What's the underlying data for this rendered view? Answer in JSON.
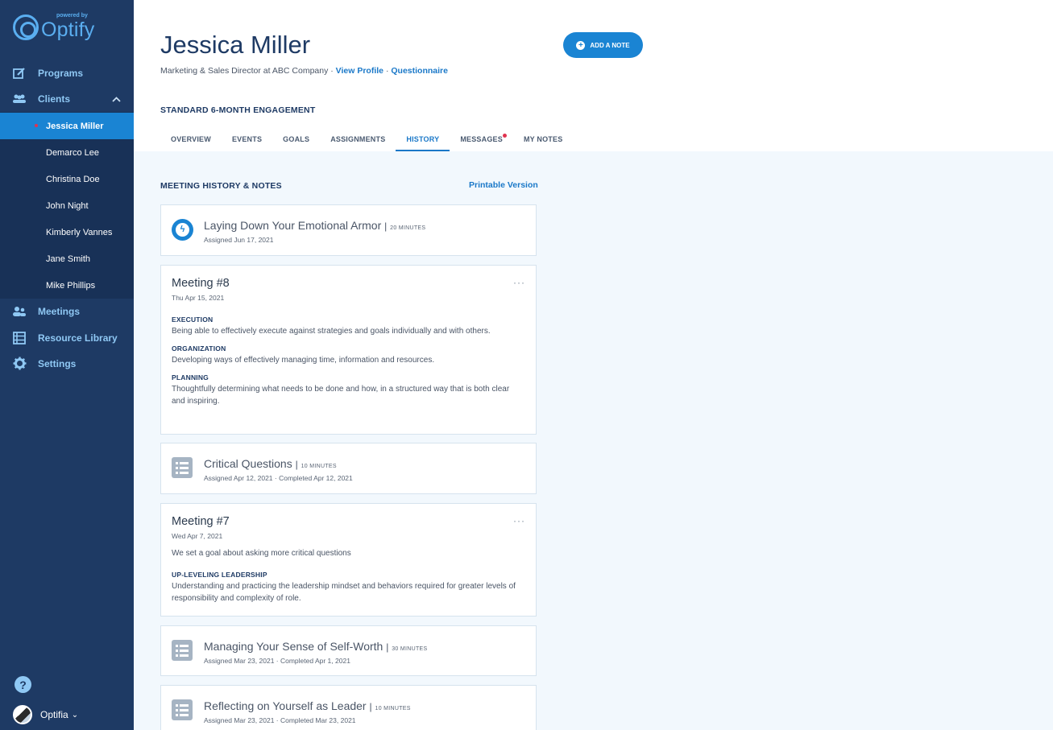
{
  "brand": {
    "powered_by": "powered by",
    "name": "Optify"
  },
  "nav": {
    "programs": "Programs",
    "clients": "Clients",
    "meetings": "Meetings",
    "resource_library": "Resource Library",
    "settings": "Settings"
  },
  "clients": [
    "Jessica Miller",
    "Demarco Lee",
    "Christina Doe",
    "John Night",
    "Kimberly Vannes",
    "Jane Smith",
    "Mike Phillips"
  ],
  "user": {
    "name": "Optifia",
    "caret": "⌄"
  },
  "header": {
    "client_name": "Jessica Miller",
    "role": "Marketing & Sales Director at ABC Company ·",
    "view_profile": "View Profile",
    "dot": "·",
    "questionnaire": "Questionnaire",
    "add_note": "ADD A NOTE",
    "engagement": "STANDARD 6-MONTH ENGAGEMENT"
  },
  "tabs": [
    "OVERVIEW",
    "EVENTS",
    "GOALS",
    "ASSIGNMENTS",
    "HISTORY",
    "MESSAGES",
    "MY NOTES"
  ],
  "history": {
    "title": "MEETING HISTORY & NOTES",
    "printable": "Printable Version",
    "items": [
      {
        "title": "Laying Down Your Emotional Armor",
        "duration": "20 MINUTES",
        "sub": "Assigned Jun 17, 2021"
      },
      {
        "title": "Meeting #8",
        "date": "Thu Apr 15, 2021",
        "more": "···",
        "topics": [
          {
            "name": "EXECUTION",
            "desc": "Being able to effectively execute against strategies and goals individually and with others."
          },
          {
            "name": "ORGANIZATION",
            "desc": "Developing ways of effectively managing time, information and resources."
          },
          {
            "name": "PLANNING",
            "desc": "Thoughtfully determining what needs to be done and how, in a structured way that is both clear and inspiring."
          }
        ]
      },
      {
        "title": "Critical Questions",
        "duration": "10 MINUTES",
        "sub": "Assigned Apr 12, 2021 · Completed Apr 12, 2021"
      },
      {
        "title": "Meeting #7",
        "date": "Wed Apr 7, 2021",
        "more": "···",
        "note": "We set a goal about asking more critical questions",
        "topics": [
          {
            "name": "UP-LEVELING LEADERSHIP",
            "desc": "Understanding and practicing the leadership mindset and behaviors required for greater levels of responsibility and complexity of role."
          }
        ]
      },
      {
        "title": "Managing Your Sense of Self-Worth",
        "duration": "30 MINUTES",
        "sub": "Assigned Mar 23, 2021 · Completed Apr 1, 2021"
      },
      {
        "title": "Reflecting on Yourself as Leader",
        "duration": "10 MINUTES",
        "sub": "Assigned Mar 23, 2021 · Completed Mar 23, 2021"
      }
    ]
  },
  "icons": {
    "programs": "edit-icon",
    "clients": "people-icon",
    "meetings": "meeting-icon",
    "resource_library": "library-icon",
    "settings": "gear-icon",
    "help": "help-icon"
  },
  "colors": {
    "sidebar": "#1e3a64",
    "accent": "#1a84d3",
    "content_bg": "#f2f8fd",
    "badge": "#e0334f"
  }
}
